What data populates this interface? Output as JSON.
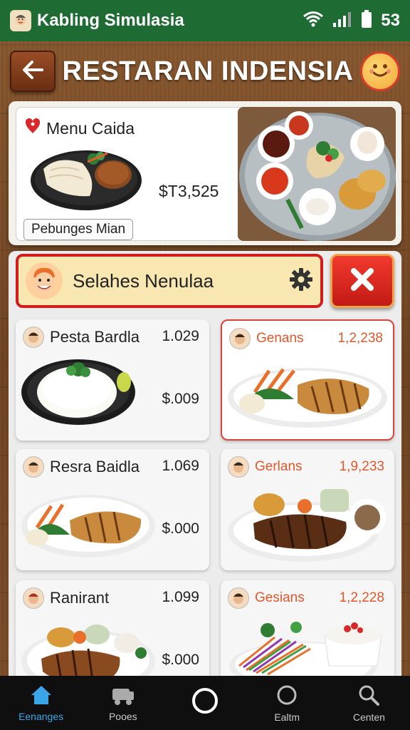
{
  "status_bar": {
    "app_name": "Kabling Simulasia",
    "time": "53"
  },
  "header": {
    "title": "RESTARAN INDENSIA"
  },
  "featured": {
    "heading": "Menu Caida",
    "price": "$T3,525",
    "tag": "Pebunges Mian"
  },
  "search": {
    "text": "Selahes Nenulaa"
  },
  "menu": [
    {
      "name": "Pesta Bardla",
      "count": "1.029",
      "price": "$.009"
    },
    {
      "name": "Genans",
      "count": "1,2,238",
      "price": ""
    },
    {
      "name": "Resra Baidla",
      "count": "1.069",
      "price": "$.000"
    },
    {
      "name": "Gerlans",
      "count": "1,9,233",
      "price": ""
    },
    {
      "name": "Ranirant",
      "count": "1.099",
      "price": "$.000"
    },
    {
      "name": "Gesians",
      "count": "1,2,228",
      "price": ""
    }
  ],
  "nav": [
    {
      "label": "Eenanges",
      "icon": "home-icon"
    },
    {
      "label": "Pooes",
      "icon": "cart-icon"
    },
    {
      "label": "",
      "icon": "circle-icon"
    },
    {
      "label": "Ealtm",
      "icon": "circle-outline-icon"
    },
    {
      "label": "Centen",
      "icon": "search-icon"
    }
  ],
  "colors": {
    "status_bar": "#1f6b34",
    "accent_red": "#d21d1d",
    "nav_active": "#3aa6e8",
    "alt_title": "#e2572a"
  }
}
